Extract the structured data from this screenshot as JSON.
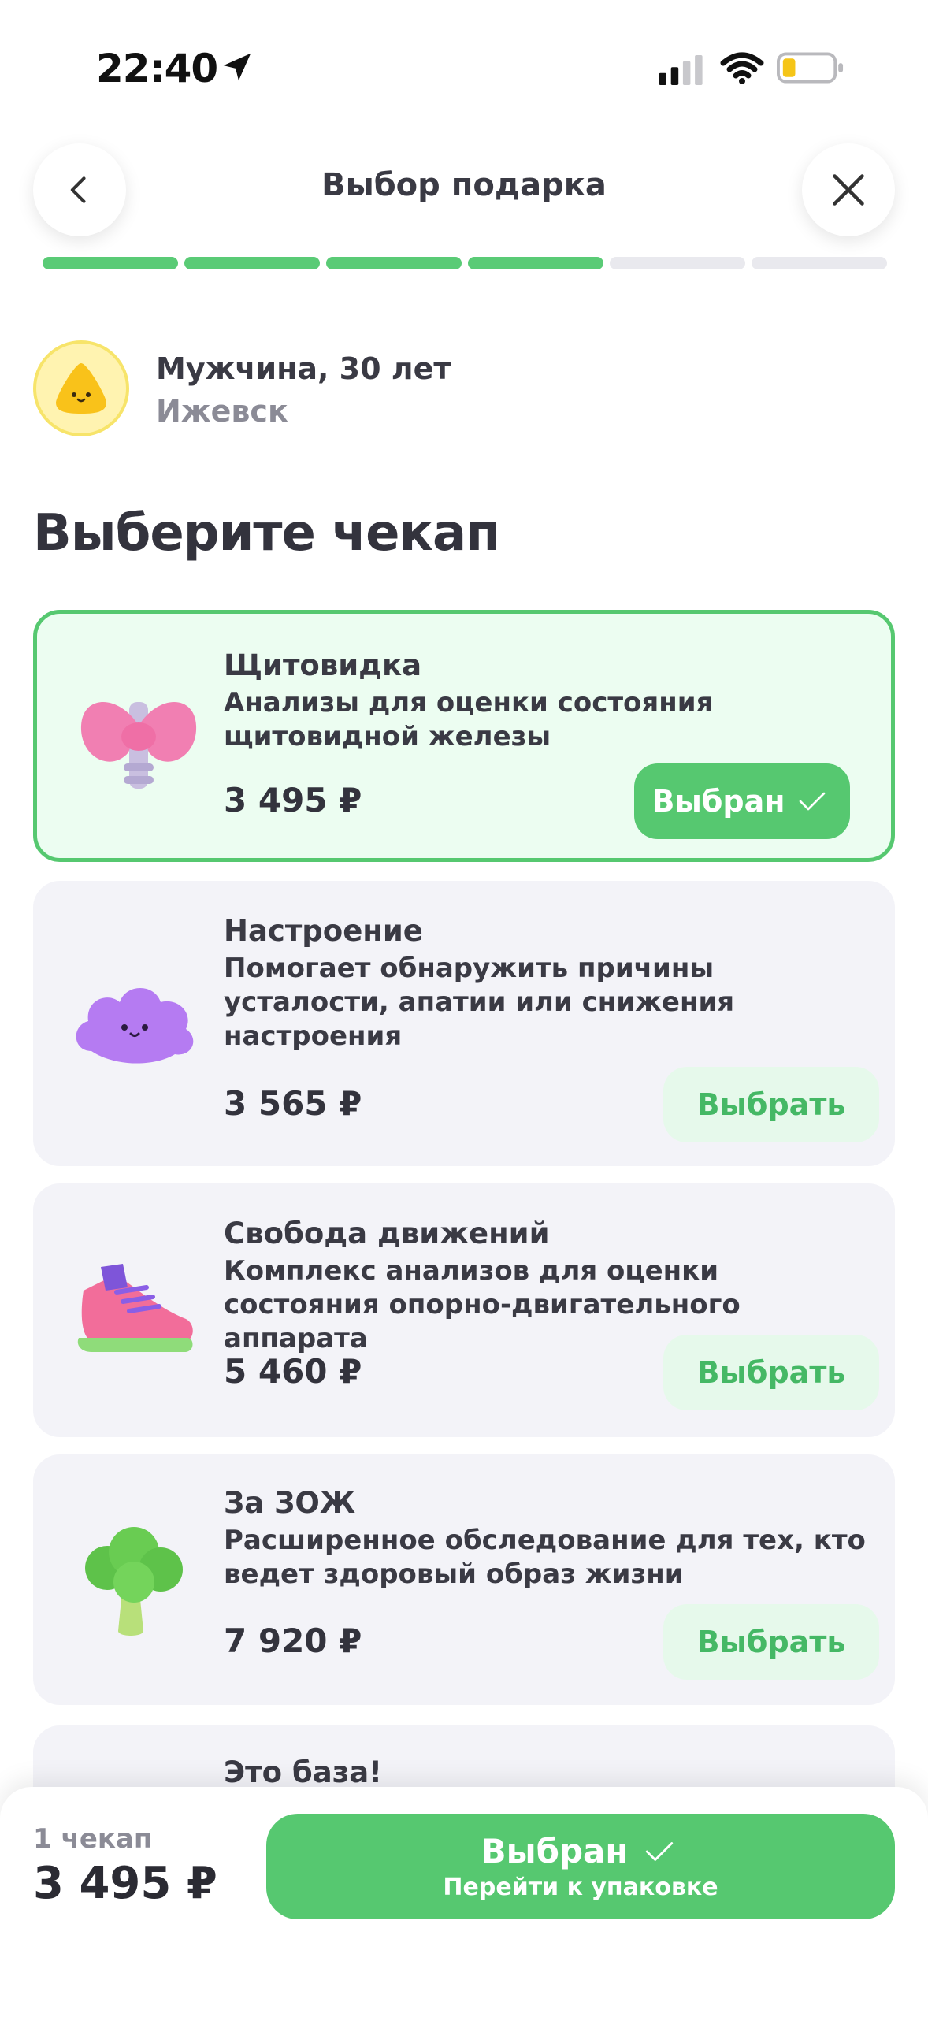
{
  "status_bar": {
    "time": "22:40"
  },
  "header": {
    "title": "Выбор подарка",
    "progress": {
      "total_steps": 6,
      "completed_steps": 4
    }
  },
  "profile": {
    "name": "Мужчина, 30 лет",
    "city": "Ижевск"
  },
  "heading": "Выберите чекап",
  "checkups": [
    {
      "title": "Щитовидка",
      "desc": "Анализы для оценки состояния щитовидной железы",
      "price": "3 495 ₽",
      "button": "Выбран",
      "selected": true,
      "icon": "thyroid-icon"
    },
    {
      "title": "Настроение",
      "desc": "Помогает обнаружить  причины усталости, апатии или снижения настроения",
      "price": "3 565 ₽",
      "button": "Выбрать",
      "selected": false,
      "icon": "cloud-icon"
    },
    {
      "title": "Свобода движений",
      "desc": "Комплекс анализов для оценки состояния опорно-двигательного аппарата",
      "price": "5 460 ₽",
      "button": "Выбрать",
      "selected": false,
      "icon": "sneaker-icon"
    },
    {
      "title": "За ЗОЖ",
      "desc": "Расширенное обследование для тех, кто ведет здоровый образ жизни",
      "price": "7 920 ₽",
      "button": "Выбрать",
      "selected": false,
      "icon": "broccoli-icon"
    },
    {
      "title": "Это база!"
    }
  ],
  "footer": {
    "count": "1 чекап",
    "total": "3 495 ₽",
    "button_label": "Выбран",
    "button_sub": "Перейти к упаковке"
  },
  "colors": {
    "accent": "#56c870",
    "selected_bg": "#ecfdf1",
    "card_bg": "#f3f3f8",
    "text": "#3a3a44"
  }
}
